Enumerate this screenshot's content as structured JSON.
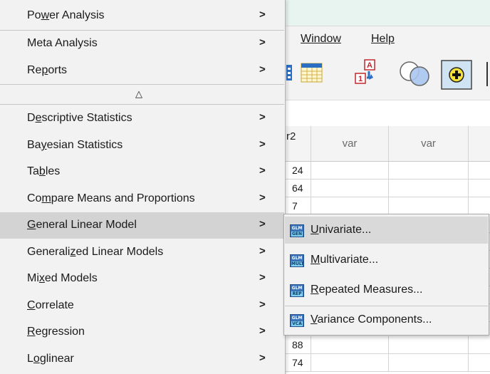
{
  "app_menubar": {
    "window": "Window",
    "help": "Help"
  },
  "toolbar": {
    "icons": [
      "data-sheet-icon",
      "recode-icon",
      "venn-select-icon",
      "add-variable-icon"
    ],
    "recode_top": "A",
    "recode_bottom": "1"
  },
  "grid": {
    "col_header_partial": "r2",
    "col_headers": [
      "var",
      "var"
    ],
    "values": [
      "24",
      "64",
      "7",
      "88",
      "74"
    ]
  },
  "menu": {
    "items": [
      {
        "pre": "Po",
        "key": "w",
        "post": "er Analysis"
      },
      {
        "pre": "Meta Analysis",
        "key": "",
        "post": ""
      },
      {
        "pre": "Re",
        "key": "p",
        "post": "orts"
      },
      {
        "pre": "D",
        "key": "e",
        "post": "scriptive Statistics"
      },
      {
        "pre": "Ba",
        "key": "y",
        "post": "esian Statistics"
      },
      {
        "pre": "Ta",
        "key": "b",
        "post": "les"
      },
      {
        "pre": "Co",
        "key": "m",
        "post": "pare Means and Proportions"
      },
      {
        "pre": "",
        "key": "G",
        "post": "eneral Linear Model"
      },
      {
        "pre": "Generali",
        "key": "z",
        "post": "ed Linear Models"
      },
      {
        "pre": "Mi",
        "key": "x",
        "post": "ed Models"
      },
      {
        "pre": "",
        "key": "C",
        "post": "orrelate"
      },
      {
        "pre": "",
        "key": "R",
        "post": "egression"
      },
      {
        "pre": "L",
        "key": "o",
        "post": "glinear"
      }
    ],
    "arrow": ">",
    "scroll_up_glyph": "△"
  },
  "submenu": {
    "items": [
      {
        "icon_top": "GLM",
        "icon_bottom": "GEN",
        "pre": "",
        "key": "U",
        "post": "nivariate..."
      },
      {
        "icon_top": "GLM",
        "icon_bottom": "MULT",
        "pre": "",
        "key": "M",
        "post": "ultivariate..."
      },
      {
        "icon_top": "GLM",
        "icon_bottom": "REP",
        "pre": "",
        "key": "R",
        "post": "epeated Measures..."
      },
      {
        "icon_top": "GLM",
        "icon_bottom": "VCA",
        "pre": "",
        "key": "V",
        "post": "ariance Components..."
      }
    ]
  },
  "colors": {
    "highlight": "#d3d3d3",
    "menu_bg": "#f2f2f2",
    "accent": "#3c72b8"
  }
}
